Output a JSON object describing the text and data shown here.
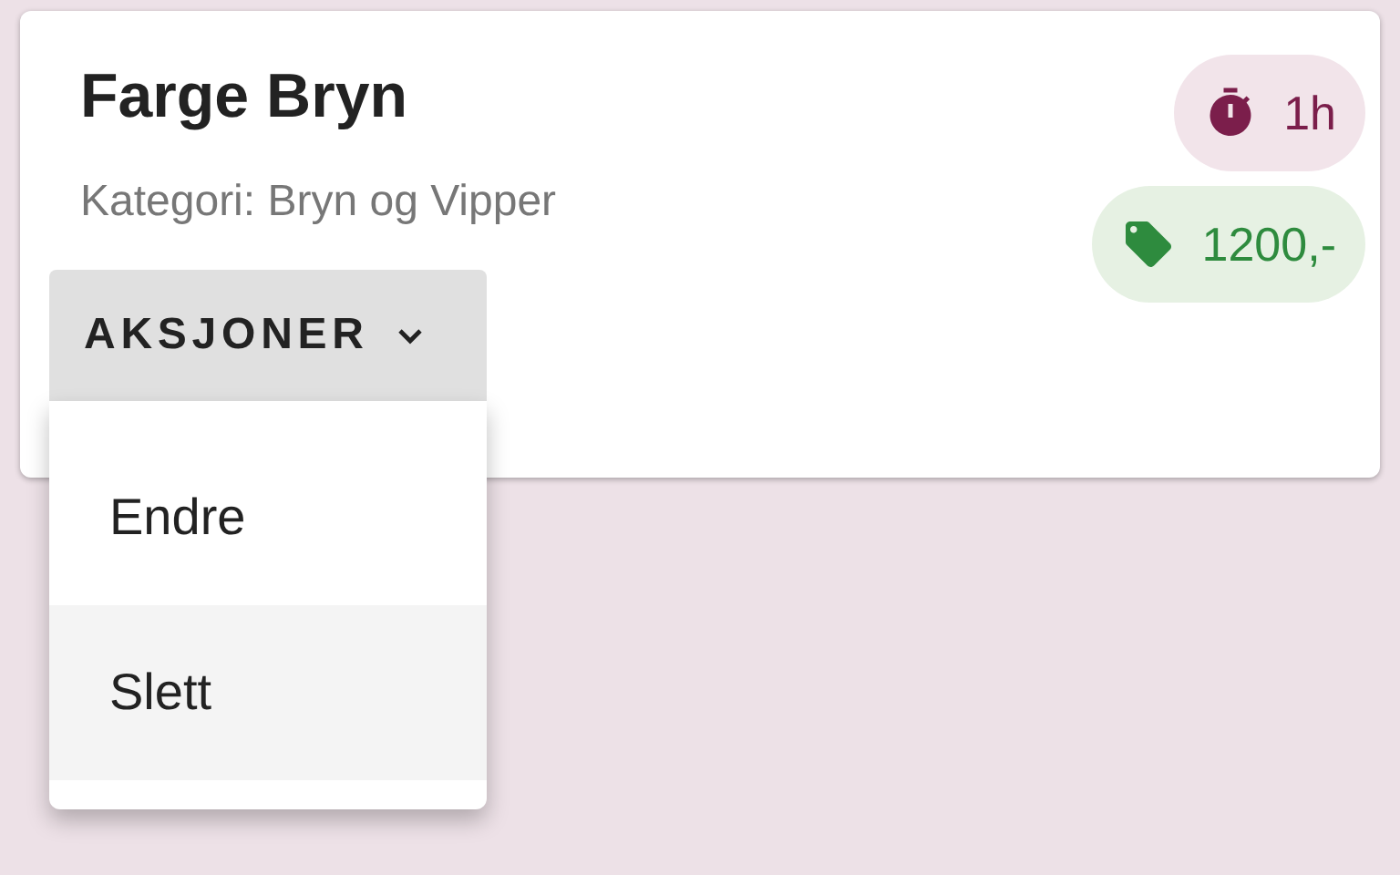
{
  "card": {
    "title": "Farge Bryn",
    "category": "Kategori: Bryn og Vipper",
    "chips": [
      {
        "kind": "duration",
        "label": "1h"
      },
      {
        "kind": "price",
        "label": "1200,-"
      }
    ],
    "actions": {
      "label": "AKSJONER",
      "expanded": true,
      "items": [
        {
          "label": "Endre",
          "selected": false
        },
        {
          "label": "Slett",
          "selected": true
        }
      ]
    }
  }
}
